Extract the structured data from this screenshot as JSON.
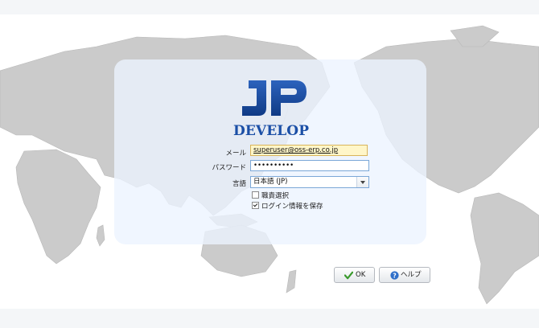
{
  "logo": {
    "text": "JP",
    "subtitle": "DEVELOP"
  },
  "form": {
    "email_label": "メール",
    "email_value": "superuser@oss-erp.co.jp",
    "password_label": "パスワード",
    "password_value": "••••••••••",
    "language_label": "言語",
    "language_value": "日本語 (JP)",
    "select_role_label": "職責選択",
    "save_login_label": "ログイン情報を保存",
    "select_role_checked": false,
    "save_login_checked": true
  },
  "buttons": {
    "ok_label": "OK",
    "help_label": "ヘルプ"
  },
  "colors": {
    "logo_blue": "#1b4fa6",
    "panel": "#eaf1ff",
    "map_land": "#c9c9c9"
  },
  "icons": {
    "ok": "check-icon",
    "help": "question-icon",
    "dropdown": "chevron-down-icon"
  }
}
